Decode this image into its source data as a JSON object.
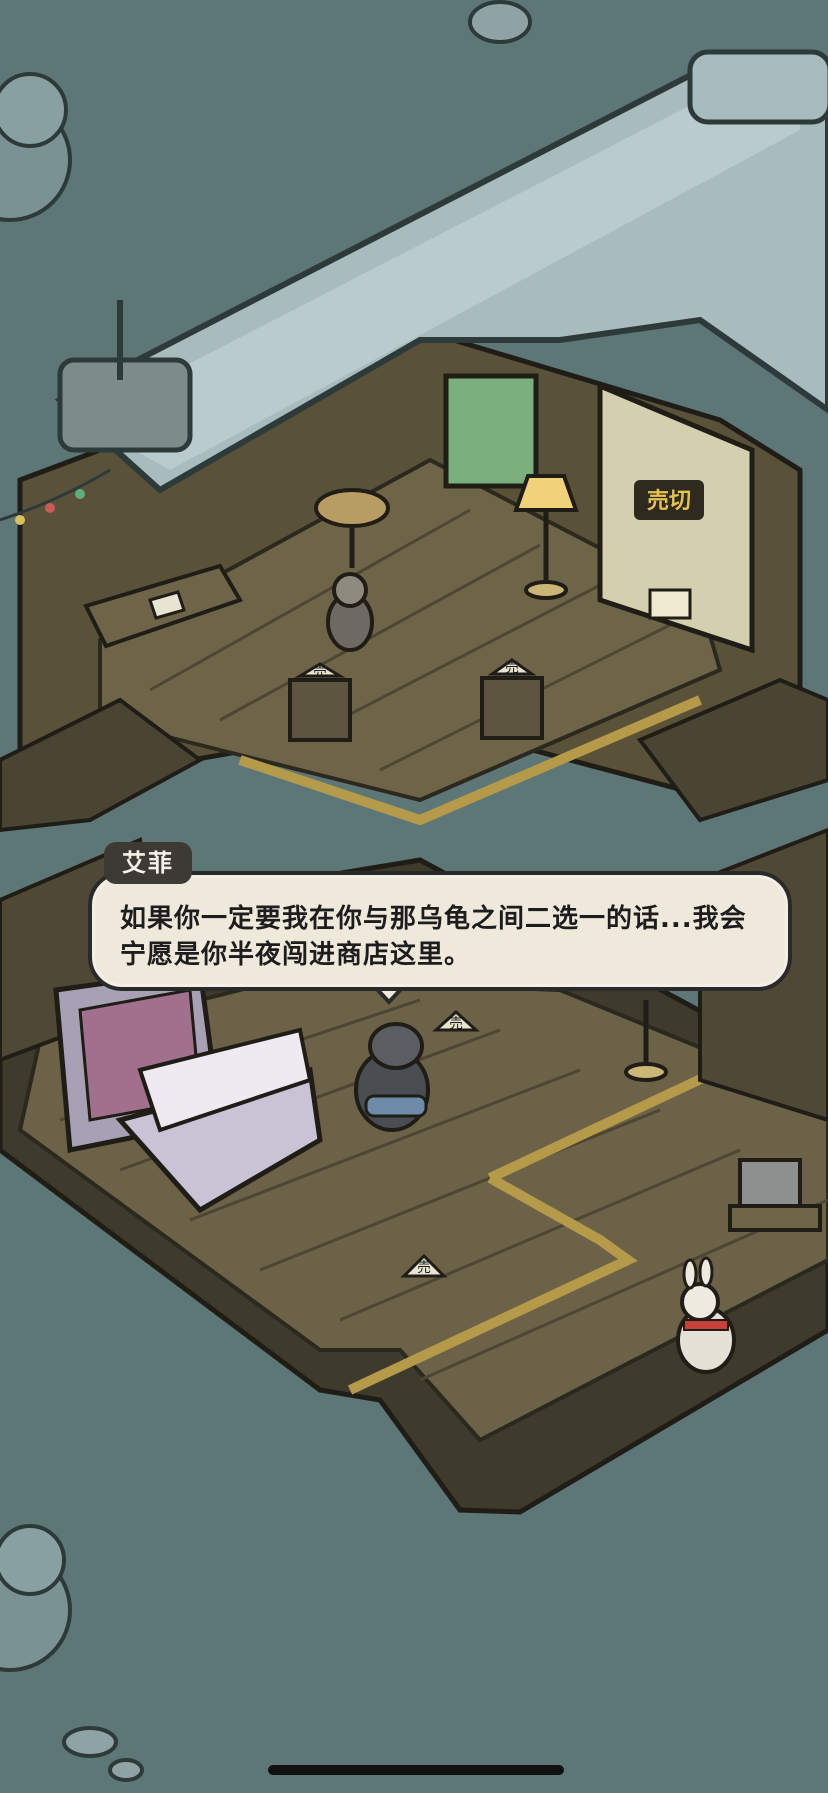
{
  "dialog": {
    "speaker": "艾菲",
    "text": "如果你一定要我在你与那乌龟之间二选一的话...我会宁愿是你半夜闯进商店这里。"
  },
  "signs": {
    "price_tag": "売",
    "door_sign": "売切"
  },
  "colors": {
    "ground": "#5d7676",
    "snow": "#a8bcbd",
    "wood_dark": "#3e3a2c",
    "wood_floor": "#6b6248",
    "dialog_bg": "#efe9dc",
    "name_tag_bg": "#3d3a36"
  }
}
